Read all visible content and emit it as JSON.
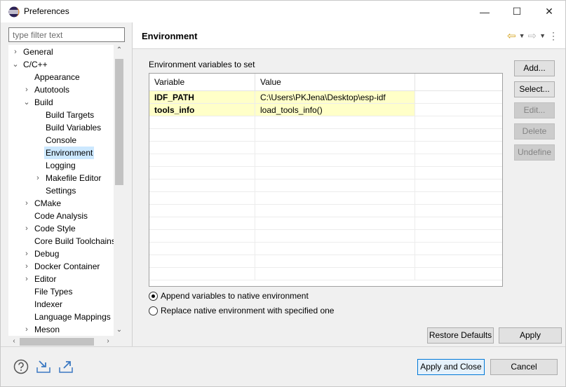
{
  "window": {
    "title": "Preferences",
    "controls": {
      "minimize": "—",
      "maximize": "☐",
      "close": "✕"
    }
  },
  "filter": {
    "placeholder": "type filter text",
    "value": ""
  },
  "tree": [
    {
      "label": "General",
      "indent": 0,
      "chevron": "›",
      "selected": false
    },
    {
      "label": "C/C++",
      "indent": 0,
      "chevron": "⌄",
      "selected": false
    },
    {
      "label": "Appearance",
      "indent": 1,
      "chevron": "",
      "selected": false
    },
    {
      "label": "Autotools",
      "indent": 1,
      "chevron": "›",
      "selected": false
    },
    {
      "label": "Build",
      "indent": 1,
      "chevron": "⌄",
      "selected": false
    },
    {
      "label": "Build Targets",
      "indent": 2,
      "chevron": "",
      "selected": false
    },
    {
      "label": "Build Variables",
      "indent": 2,
      "chevron": "",
      "selected": false
    },
    {
      "label": "Console",
      "indent": 2,
      "chevron": "",
      "selected": false
    },
    {
      "label": "Environment",
      "indent": 2,
      "chevron": "",
      "selected": true
    },
    {
      "label": "Logging",
      "indent": 2,
      "chevron": "",
      "selected": false
    },
    {
      "label": "Makefile Editor",
      "indent": 2,
      "chevron": "›",
      "selected": false
    },
    {
      "label": "Settings",
      "indent": 2,
      "chevron": "",
      "selected": false
    },
    {
      "label": "CMake",
      "indent": 1,
      "chevron": "›",
      "selected": false
    },
    {
      "label": "Code Analysis",
      "indent": 1,
      "chevron": "",
      "selected": false
    },
    {
      "label": "Code Style",
      "indent": 1,
      "chevron": "›",
      "selected": false
    },
    {
      "label": "Core Build Toolchains",
      "indent": 1,
      "chevron": "",
      "selected": false
    },
    {
      "label": "Debug",
      "indent": 1,
      "chevron": "›",
      "selected": false
    },
    {
      "label": "Docker Container",
      "indent": 1,
      "chevron": "›",
      "selected": false
    },
    {
      "label": "Editor",
      "indent": 1,
      "chevron": "›",
      "selected": false
    },
    {
      "label": "File Types",
      "indent": 1,
      "chevron": "",
      "selected": false
    },
    {
      "label": "Indexer",
      "indent": 1,
      "chevron": "",
      "selected": false
    },
    {
      "label": "Language Mappings",
      "indent": 1,
      "chevron": "",
      "selected": false
    },
    {
      "label": "Meson",
      "indent": 1,
      "chevron": "›",
      "selected": false
    }
  ],
  "scroll": {
    "up": "⌃",
    "down": "⌄",
    "left": "‹",
    "right": "›"
  },
  "page": {
    "title": "Environment",
    "nav": {
      "back": "⇦",
      "forward": "⇨",
      "dropdown": "▼",
      "menu": "⋮"
    }
  },
  "env": {
    "group_label": "Environment variables to set",
    "columns": [
      "Variable",
      "Value"
    ],
    "rows": [
      {
        "variable": "IDF_PATH",
        "value": "C:\\Users\\PKJena\\Desktop\\esp-idf"
      },
      {
        "variable": "tools_info",
        "value": " load_tools_info()"
      }
    ],
    "empty_rows": 13
  },
  "buttons": {
    "add": "Add...",
    "select": "Select...",
    "edit": "Edit...",
    "delete": "Delete",
    "undefine": "Undefine",
    "restore_defaults": "Restore Defaults",
    "apply": "Apply",
    "apply_and_close": "Apply and Close",
    "cancel": "Cancel"
  },
  "radios": [
    {
      "label": "Append variables to native environment",
      "checked": true
    },
    {
      "label": "Replace native environment with specified one",
      "checked": false
    }
  ],
  "colors": {
    "highlight_row": "#ffffc8",
    "selection": "#cce8ff",
    "back_arrow": "#d4a017"
  }
}
